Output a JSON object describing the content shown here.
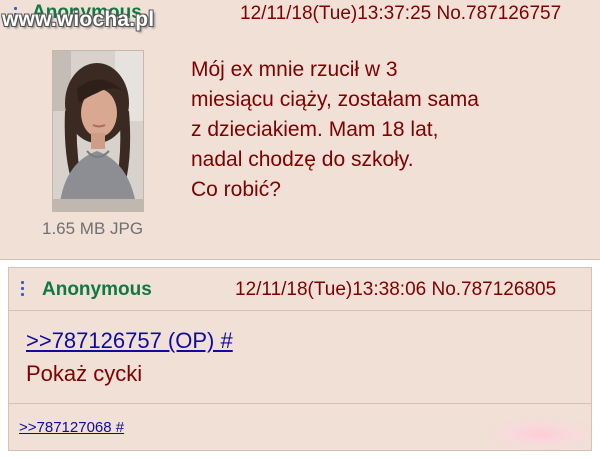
{
  "watermark": "www.wiocha.pl",
  "post1": {
    "name": "Anonymous",
    "meta": "12/11/18(Tue)13:37:25 No.787126757",
    "file_info": "1.65 MB JPG",
    "message_lines": [
      "Mój ex mnie rzucił w 3",
      "miesiącu ciąży, zostałam sama",
      "z dzieciakiem. Mam 18 lat,",
      "nadal chodzę do szkoły.",
      "Co robić?"
    ]
  },
  "post2": {
    "name": "Anonymous",
    "meta": "12/11/18(Tue)13:38:06 No.787126805",
    "quote_link": ">>787126757 (OP) #",
    "message": "Pokaż cycki",
    "reply_link": ">>787127068 #"
  },
  "colors": {
    "post_bg": "#f0e0d6",
    "name": "#117743",
    "text": "#800000",
    "link": "#0f0c9d"
  }
}
